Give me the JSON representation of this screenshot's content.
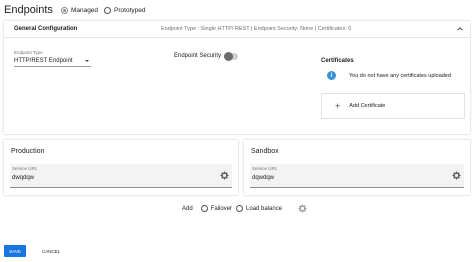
{
  "header": {
    "title": "Endpoints",
    "radio_options": [
      "Managed",
      "Prototyped"
    ],
    "selected": "Managed"
  },
  "general": {
    "label": "General Configuration",
    "summary": "Endpoint Type : Single HTTP/ REST | Endpoint Security: None | Certificates: 0",
    "endpoint_type_label": "Endpoint Type",
    "endpoint_type_value": "HTTP/REST Endpoint",
    "endpoint_security_label": "Endpoint Security",
    "endpoint_security_on": false,
    "certificates_title": "Certificates",
    "certificates_info": "You do not have any certificates uploaded",
    "add_certificate": "Add Certificate"
  },
  "production": {
    "title": "Production",
    "url_label": "Service URL",
    "url_value": "dwqdqw"
  },
  "sandbox": {
    "title": "Sandbox",
    "url_label": "Service URL",
    "url_value": "dqwdqw"
  },
  "add_row": {
    "label": "Add",
    "options": [
      "Failover",
      "Load balance"
    ]
  },
  "footer": {
    "save": "SAVE",
    "cancel": "CANCEL"
  },
  "colors": {
    "primary": "#1875e0",
    "info": "#3b8fd6"
  }
}
